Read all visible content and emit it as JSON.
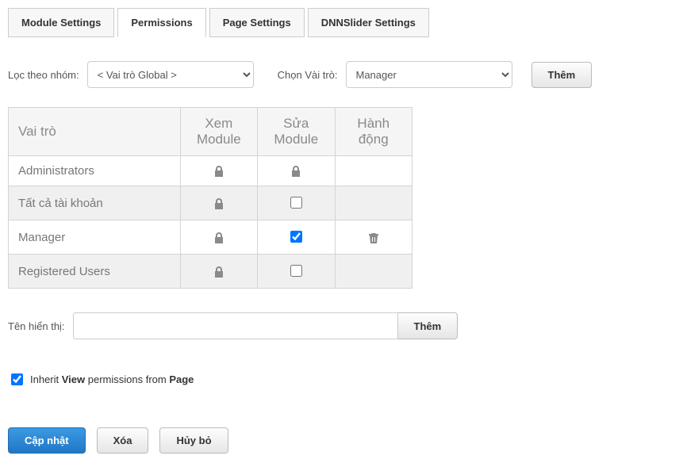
{
  "tabs": [
    {
      "label": "Module Settings",
      "active": false
    },
    {
      "label": "Permissions",
      "active": true
    },
    {
      "label": "Page Settings",
      "active": false
    },
    {
      "label": "DNNSlider Settings",
      "active": false
    }
  ],
  "filter": {
    "group_label": "Lọc theo nhóm:",
    "group_value": "< Vai trò Global >",
    "role_label": "Chọn Vài trò:",
    "role_value": "Manager",
    "add_label": "Thêm"
  },
  "table": {
    "headers": {
      "role": "Vai trò",
      "view": "Xem Module",
      "edit": "Sửa Module",
      "action": "Hành động"
    },
    "rows": [
      {
        "role": "Administrators",
        "view": "lock",
        "edit": "lock",
        "action": ""
      },
      {
        "role": "Tất cả tài khoản",
        "view": "lock",
        "edit": "unchecked",
        "action": ""
      },
      {
        "role": "Manager",
        "view": "lock",
        "edit": "checked",
        "action": "trash"
      },
      {
        "role": "Registered Users",
        "view": "lock",
        "edit": "unchecked",
        "action": ""
      }
    ]
  },
  "displayname": {
    "label": "Tên hiển thị:",
    "value": "",
    "add_label": "Thêm"
  },
  "inherit": {
    "checked": true,
    "prefix": "Inherit ",
    "bold1": "View",
    "mid": " permissions from ",
    "bold2": "Page"
  },
  "actions": {
    "update": "Cập nhật",
    "delete": "Xóa",
    "cancel": "Hủy bỏ"
  }
}
